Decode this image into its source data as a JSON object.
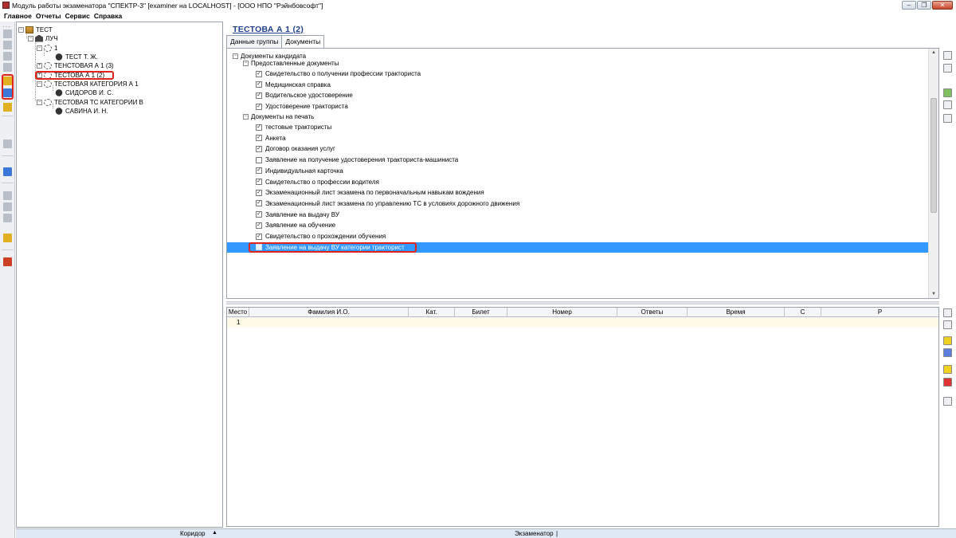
{
  "window": {
    "title": "Модуль работы экзаменатора \"СПЕКТР-3\" [examiner на LOCALHOST] - [ООО НПО \"Рэйнбовсофт\"]",
    "buttons": [
      "‒",
      "❐",
      "✕"
    ]
  },
  "menu": [
    "Главное",
    "Отчеты",
    "Сервис",
    "Справка"
  ],
  "tree": {
    "root": "ТЕСТ",
    "org": "ЛУЧ",
    "group1": "1",
    "person1": "ТЕСТ Т. Ж.",
    "group2": "ТЕНСТОВАЯ А 1 (3)",
    "group3": "ТЕСТОВА А 1 (2)",
    "group4": "ТЕСТОВАЯ КАТЕГОРИЯ А 1",
    "person2": "СИДОРОВ И. С.",
    "group5": "ТЕСТОВАЯ ТС КАТЕГОРИИ В",
    "person3": "САВИНА И. Н."
  },
  "candidate": {
    "title": "ТЕСТОВА А 1 (2)"
  },
  "tabs": [
    "Данные группы",
    "Документы"
  ],
  "documents": {
    "root": "Документы кандидата",
    "provided_header": "Предоставленные документы",
    "provided": [
      {
        "label": "Свидетельство о получении профессии тракториста",
        "checked": true
      },
      {
        "label": "Медицинская справка",
        "checked": true
      },
      {
        "label": "Водительское удостоверение",
        "checked": true
      },
      {
        "label": "Удостоверение тракториста",
        "checked": true
      }
    ],
    "print_header": "Документы на печать",
    "print": [
      {
        "label": "тестовые трактористы",
        "checked": true
      },
      {
        "label": "Анкета",
        "checked": true
      },
      {
        "label": "Договор оказания услуг",
        "checked": true
      },
      {
        "label": "Заявление на получение удостоверения тракториста-машиниста",
        "checked": false
      },
      {
        "label": "Индивидуальная карточка",
        "checked": true
      },
      {
        "label": "Свидетельство о профессии водителя",
        "checked": true
      },
      {
        "label": "Экзаменационный лист экзамена по первоначальным навыкам вождения",
        "checked": true
      },
      {
        "label": "Экзаменационный лист экзамена по управлению ТС в условиях дорожного движения",
        "checked": true
      },
      {
        "label": "Заявление на выдачу ВУ",
        "checked": true
      },
      {
        "label": "Заявление на обучение",
        "checked": true
      },
      {
        "label": "Свидетельство о прохождении обучения",
        "checked": true
      },
      {
        "label": "Заявление на выдачу ВУ категории тракторист",
        "checked": false,
        "selected": true
      }
    ]
  },
  "grid": {
    "columns": [
      "Место",
      "Фамилия И.О.",
      "Кат.",
      "Билет",
      "Номер",
      "Ответы",
      "Время",
      "С",
      "Р"
    ],
    "rows": [
      [
        "1",
        "",
        "",
        "",
        "",
        "",
        "",
        "",
        ""
      ]
    ]
  },
  "status": {
    "left": "Коридор",
    "right": "Экзаменатор"
  },
  "colors": {
    "selection": "#3399ff",
    "highlight_border": "#e0241c",
    "title_link": "#1f3f8f",
    "status_bar": "#dfe9f5"
  }
}
